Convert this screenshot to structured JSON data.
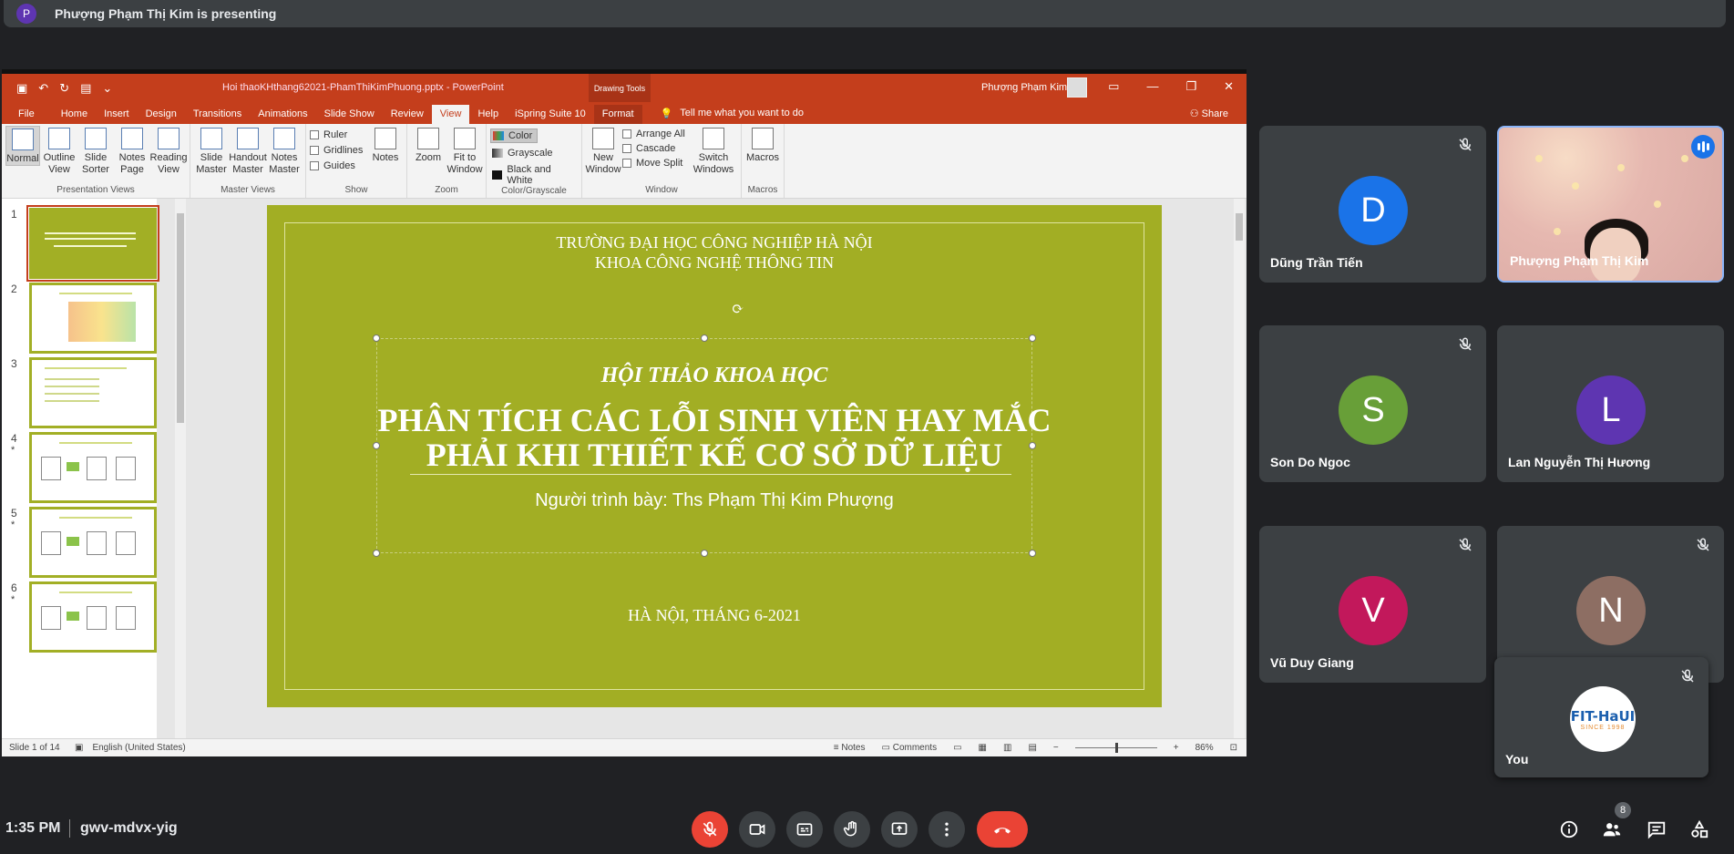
{
  "presenter": {
    "initial": "P",
    "text": "Phượng Phạm Thị Kim is presenting"
  },
  "ppt": {
    "doc_title": "Hoi thaoKHthang62021-PhamThiKimPhuong.pptx - PowerPoint",
    "drawing_tools": "Drawing Tools",
    "user": "Phượng Phạm Kim",
    "tabs": [
      "File",
      "Home",
      "Insert",
      "Design",
      "Transitions",
      "Animations",
      "Slide Show",
      "Review",
      "View",
      "Help",
      "iSpring Suite 10",
      "Format"
    ],
    "tell_me": "Tell me what you want to do",
    "share": "Share",
    "ribbon": {
      "presentation_views": {
        "label": "Presentation Views",
        "buttons": [
          "Normal",
          "Outline View",
          "Slide Sorter",
          "Notes Page",
          "Reading View"
        ]
      },
      "master_views": {
        "label": "Master Views",
        "buttons": [
          "Slide Master",
          "Handout Master",
          "Notes Master"
        ]
      },
      "show": {
        "label": "Show",
        "checks": [
          "Ruler",
          "Gridlines",
          "Guides"
        ],
        "notes": "Notes"
      },
      "zoom": {
        "label": "Zoom",
        "buttons": [
          "Zoom",
          "Fit to Window"
        ]
      },
      "color": {
        "label": "Color/Grayscale",
        "items": [
          "Color",
          "Grayscale",
          "Black and White"
        ]
      },
      "window": {
        "label": "Window",
        "new_window": "New Window",
        "items": [
          "Arrange All",
          "Cascade",
          "Move Split"
        ],
        "switch": "Switch Windows"
      },
      "macros": {
        "label": "Macros",
        "button": "Macros"
      }
    },
    "thumbs": [
      {
        "num": "1",
        "star": ""
      },
      {
        "num": "2",
        "star": ""
      },
      {
        "num": "3",
        "star": ""
      },
      {
        "num": "4",
        "star": "*"
      },
      {
        "num": "5",
        "star": "*"
      },
      {
        "num": "6",
        "star": "*"
      }
    ],
    "slide": {
      "school_line1": "TRƯỜNG ĐẠI HỌC CÔNG NGHIỆP HÀ NỘI",
      "school_line2": "KHOA CÔNG NGHỆ THÔNG TIN",
      "conference": "HỘI THẢO KHOA HỌC",
      "title_line1": "PHÂN TÍCH CÁC LỖI SINH VIÊN HAY MẮC",
      "title_line2": "PHẢI KHI THIẾT KẾ CƠ SỞ DỮ LIỆU",
      "presenter": "Người trình bày: Ths Phạm Thị Kim Phượng",
      "date": "HÀ NỘI, THÁNG  6-2021"
    },
    "status": {
      "slide": "Slide 1 of 14",
      "language": "English (United States)",
      "notes": "Notes",
      "comments": "Comments",
      "zoom": "86%"
    }
  },
  "participants": [
    {
      "name": "Dũng Trần Tiến",
      "initial": "D",
      "color": "#1a73e8"
    },
    {
      "name": "Phượng Phạm Thị Kim",
      "initial": "",
      "color": ""
    },
    {
      "name": "Son Do Ngoc",
      "initial": "S",
      "color": "#689f38"
    },
    {
      "name": "Lan Nguyễn Thị Hương",
      "initial": "L",
      "color": "#5e35b1"
    },
    {
      "name": "Vũ Duy Giang",
      "initial": "V",
      "color": "#c2185b"
    },
    {
      "name": "",
      "initial": "N",
      "color": "#8d6e63"
    }
  ],
  "self_tile": {
    "name": "You",
    "logo_main": "FIT-HaUI",
    "logo_sub": "SINCE 1998"
  },
  "bottom": {
    "time": "1:35 PM",
    "meeting_code": "gwv-mdvx-yig",
    "participant_count": "8"
  },
  "colors": {
    "slide_bg": "#a2ae24",
    "ppt_accent": "#c43e1c",
    "meet_bg": "#202124",
    "end_call": "#ea4335"
  }
}
